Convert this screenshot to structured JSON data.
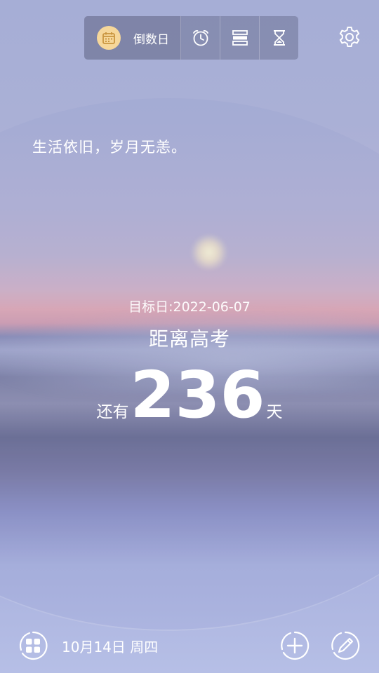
{
  "toolbar": {
    "main_label": "倒数日",
    "main_icon": "calendar-icon",
    "icons": [
      "alarm-clock-icon",
      "list-icon",
      "hourglass-icon"
    ]
  },
  "settings_icon": "gear-icon",
  "quote": "生活依旧，岁月无恙。",
  "countdown": {
    "target_date": "目标日:2022-06-07",
    "event": "距离高考",
    "prefix": "还有",
    "days": "236",
    "suffix": "天"
  },
  "bottom": {
    "date": "10月14日 周四",
    "left_icon": "grid-menu-icon",
    "add_icon": "add-icon",
    "edit_icon": "edit-icon"
  },
  "colors": {
    "calendar_badge": "#f6d79a",
    "text": "#ffffff"
  }
}
